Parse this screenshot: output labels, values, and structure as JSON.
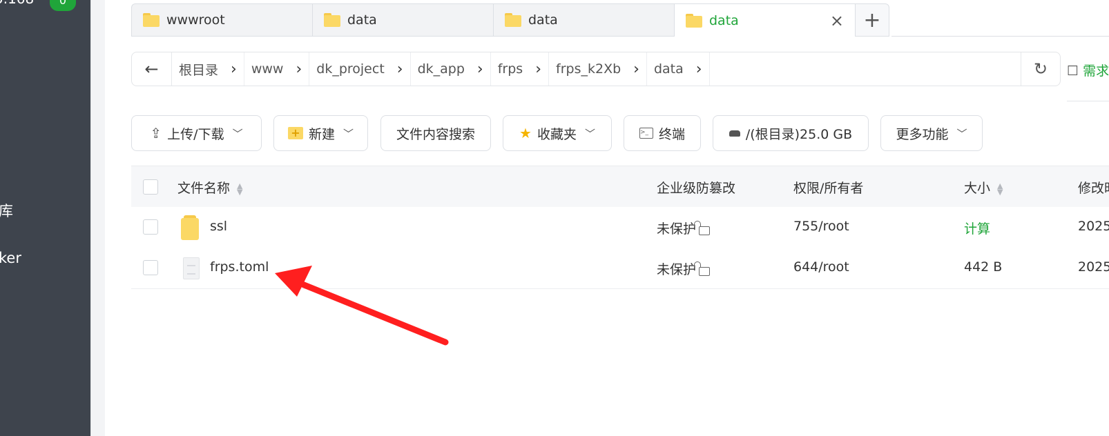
{
  "sidebar": {
    "ip_partial": "5.168",
    "badge": "0",
    "items": [
      {
        "label": "库"
      },
      {
        "label": "ker"
      }
    ]
  },
  "tabs": [
    {
      "label": "wwwroot",
      "icon": "folder-icon"
    },
    {
      "label": "data",
      "icon": "folder-icon"
    },
    {
      "label": "data",
      "icon": "folder-icon"
    },
    {
      "label": "data",
      "icon": "folder-icon",
      "active": true
    }
  ],
  "tab_close": "×",
  "tab_add": "+",
  "breadcrumb": {
    "back": "←",
    "items": [
      "根目录",
      "www",
      "dk_project",
      "dk_app",
      "frps",
      "frps_k2Xb",
      "data"
    ],
    "refresh": "↻"
  },
  "need_link": "需求",
  "toolbar": {
    "upload": "上传/下载",
    "new": "新建",
    "search": "文件内容搜索",
    "favorites": "收藏夹",
    "terminal": "终端",
    "disk": "/(根目录)25.0 GB",
    "more": "更多功能"
  },
  "table": {
    "headers": {
      "name": "文件名称",
      "protect": "企业级防篡改",
      "perm": "权限/所有者",
      "size": "大小",
      "mtime": "修改时"
    },
    "rows": [
      {
        "name": "ssl",
        "type": "folder",
        "protect": "未保护",
        "perm": "755/root",
        "size": "计算",
        "mtime": "2025"
      },
      {
        "name": "frps.toml",
        "type": "file",
        "protect": "未保护",
        "perm": "644/root",
        "size": "442 B",
        "mtime": "2025"
      }
    ]
  },
  "colors": {
    "accent": "#20a53a",
    "sidebar": "#3e444d",
    "arrow": "#ff1f1f"
  }
}
